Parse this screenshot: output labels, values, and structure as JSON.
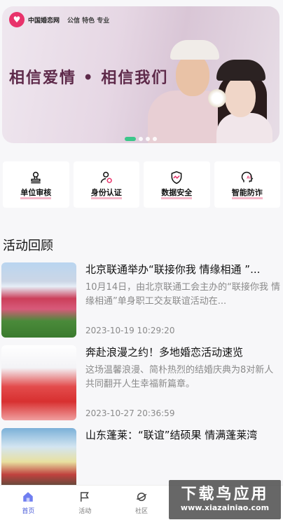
{
  "banner": {
    "brand_name": "中国婚恋网",
    "brand_slogan": "公信 特色 专业",
    "slogan": "相信爱情 • 相信我们",
    "carousel_active_index": 0,
    "carousel_count": 4
  },
  "features": [
    {
      "label": "单位审核",
      "icon": "person-stamp-icon"
    },
    {
      "label": "身份认证",
      "icon": "person-verified-icon"
    },
    {
      "label": "数据安全",
      "icon": "shield-chart-icon"
    },
    {
      "label": "智能防诈",
      "icon": "ai-head-icon"
    }
  ],
  "activity": {
    "title": "活动回顾",
    "items": [
      {
        "title": "北京联通举办“联接你我 情缘相通 ”...",
        "summary": "10月14日，由北京联通工会主办的“联接你我 情缘相通”单身职工交友联谊活动在...",
        "time": "2023-10-19 10:29:20"
      },
      {
        "title": "奔赴浪漫之约！多地婚恋活动速览",
        "summary": "这场温馨浪漫、简朴热烈的结婚庆典为8对新人共同翻开人生幸福新篇章。",
        "time": "2023-10-27 20:36:59"
      },
      {
        "title": "山东蓬莱：“联谊”结硕果 情满蓬莱湾",
        "summary": "",
        "time": ""
      }
    ]
  },
  "tabbar": {
    "items": [
      {
        "label": "首页",
        "icon": "home-icon",
        "active": true
      },
      {
        "label": "活动",
        "icon": "flag-icon",
        "active": false
      },
      {
        "label": "社区",
        "icon": "planet-icon",
        "active": false
      },
      {
        "label": "",
        "icon": "",
        "active": false
      },
      {
        "label": "",
        "icon": "",
        "active": false
      }
    ]
  },
  "watermark": {
    "main": "下载鸟应用",
    "sub": "www.xiazainiao.com"
  },
  "colors": {
    "accent_pink": "#e8336b",
    "carousel_active": "#3cc68a",
    "tab_active": "#4a5bd8",
    "underline_pink": "#f6b6c8"
  }
}
